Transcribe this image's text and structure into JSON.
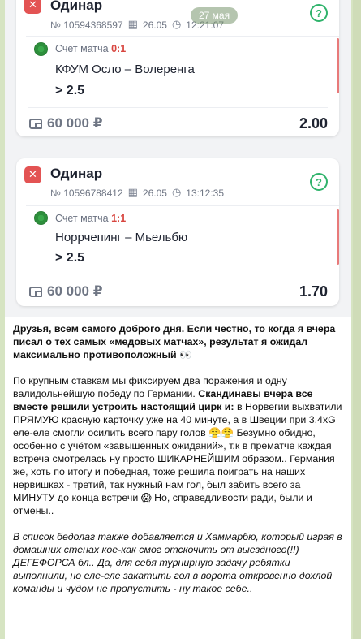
{
  "date_pill": "27 мая",
  "cards": [
    {
      "title": "Одинар",
      "number": "№ 10594368597",
      "date": "26.05",
      "time": "12:21:07",
      "score_label": "Счет матча",
      "score_value": "0:1",
      "teams": "КФУМ Осло – Волеренга",
      "pick": "> 2.5",
      "stake": "60 000 ₽",
      "odds": "2.00"
    },
    {
      "title": "Одинар",
      "number": "№ 10596788412",
      "date": "26.05",
      "time": "13:12:35",
      "score_label": "Счет матча",
      "score_value": "1:1",
      "teams": "Норрчепинг – Мьельбю",
      "pick": "> 2.5",
      "stake": "60 000 ₽",
      "odds": "1.70"
    }
  ],
  "message": {
    "p1": "Друзья, всем самого доброго дня. Если честно, то когда я вчера писал о тех самых «медовых матчах», результат я ожидал максимально противоположный 👀",
    "p2_a": "По крупным ставкам мы фиксируем два поражения и одну валидольнейшую победу по Германии. ",
    "p2_b": "Скандинавы вчера все вместе решили устроить настоящий цирк и:",
    "p2_c": " в Норвегии выхватили ПРЯМУЮ красную карточку уже на 40 минуте,  а в Швеции при 3.4xG еле-еле смогли осилить всего пару голов 😤😤 Безумно обидно, особенно с учётом «завышенных ожиданий», т.к в прематче каждая встреча смотрелась ну просто ШИКАРНЕЙШИМ образом.. Германия же, хоть по итогу и победная, тоже решила поиграть на наших нервишках  - третий, так нужный нам гол, был забить всего за МИНУТУ до конца встречи 😱 Но, справедливости ради, были и отмены..",
    "p3": "В список бедолаг также добавляется и Хаммарбю, который играя в домашних стенах кое-как смог отскочить от выездного(!!) ДЕГЕФОРСА бл.. Да, для себя турнирную задачу ребятки выполнили, но еле-еле закатить гол в ворота откровенно дохлой команды и чудом не пропустить - ну такое себе.."
  }
}
